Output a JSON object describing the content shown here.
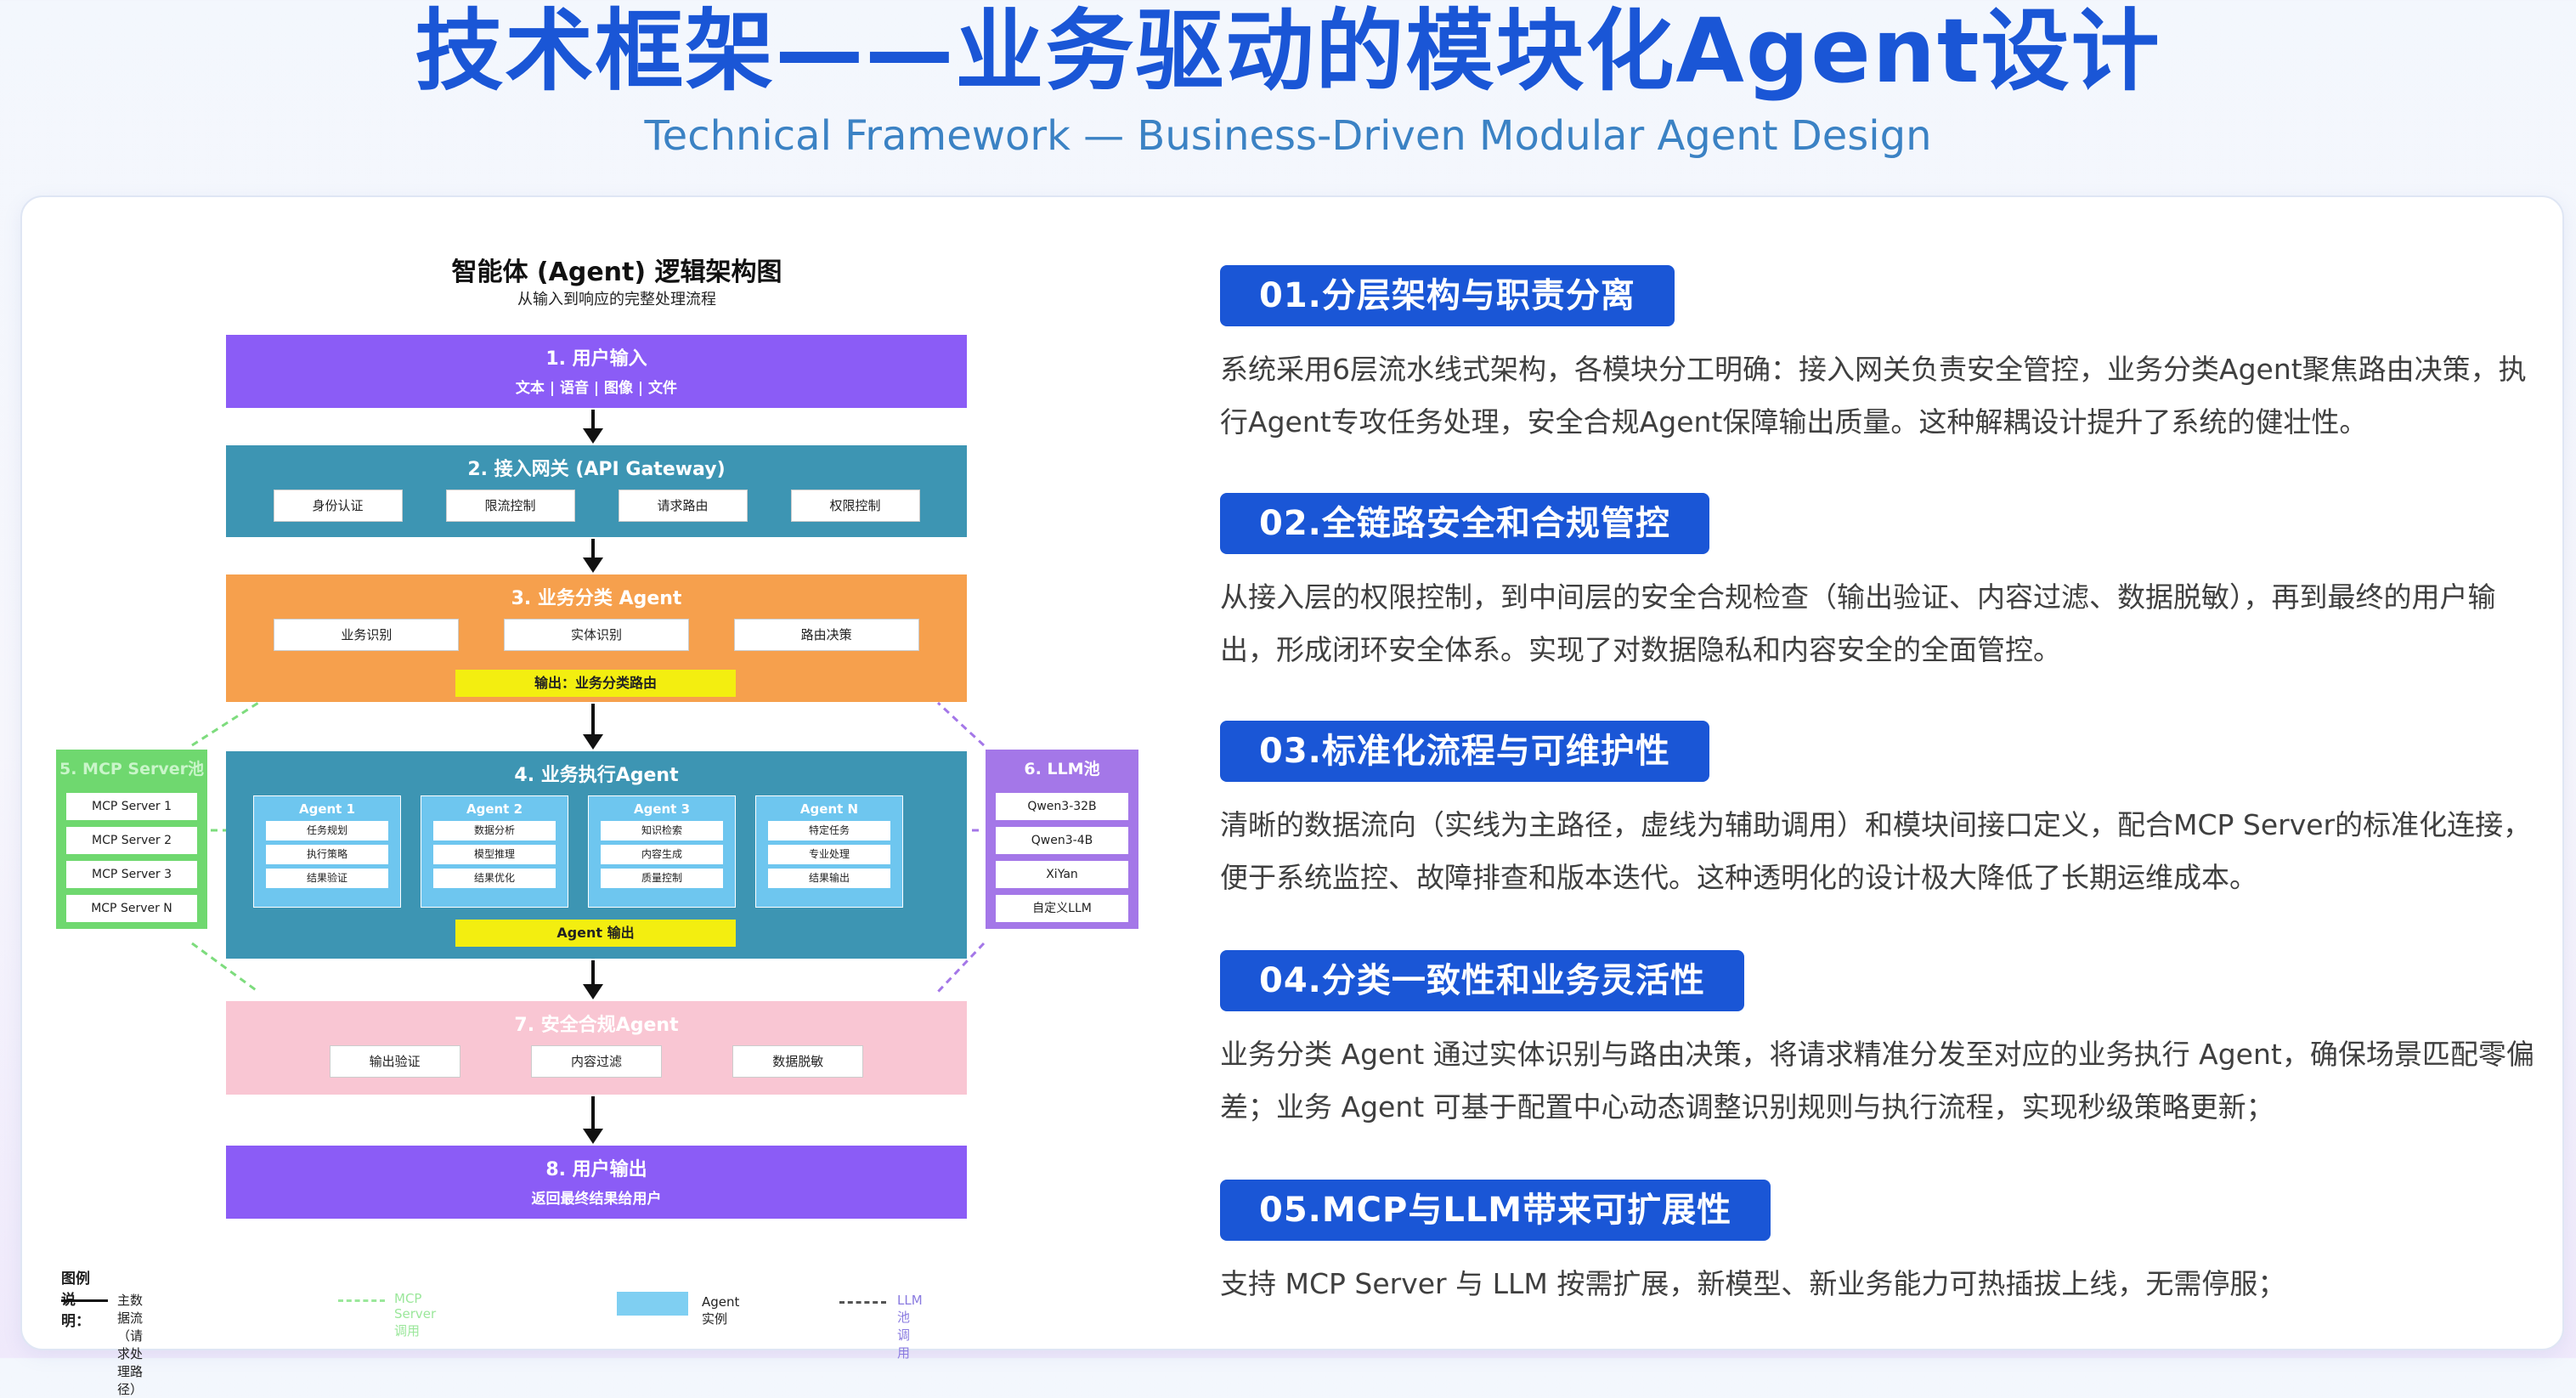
{
  "page": {
    "title": "技术框架——业务驱动的模块化Agent设计",
    "subtitle": "Technical Framework — Business-Driven Modular Agent Design"
  },
  "diagram": {
    "title": "智能体 (Agent) 逻辑架构图",
    "subtitle": "从输入到响应的完整处理流程",
    "layers": {
      "input": {
        "title": "1. 用户输入",
        "sub": "文本 | 语音 | 图像 | 文件",
        "color": "#8b5cf6"
      },
      "gateway": {
        "title": "2. 接入网关 (API Gateway)",
        "items": [
          "身份认证",
          "限流控制",
          "请求路由",
          "权限控制"
        ],
        "color": "#3d95b3"
      },
      "classify": {
        "title": "3. 业务分类 Agent",
        "items": [
          "业务识别",
          "实体识别",
          "路由决策"
        ],
        "output": "输出：业务分类路由",
        "color": "#f6a04d"
      },
      "execute": {
        "title": "4. 业务执行Agent",
        "color": "#3d95b3",
        "agents": [
          {
            "name": "Agent 1",
            "items": [
              "任务规划",
              "执行策略",
              "结果验证"
            ]
          },
          {
            "name": "Agent 2",
            "items": [
              "数据分析",
              "模型推理",
              "结果优化"
            ]
          },
          {
            "name": "Agent 3",
            "items": [
              "知识检索",
              "内容生成",
              "质量控制"
            ]
          },
          {
            "name": "Agent N",
            "items": [
              "特定任务",
              "专业处理",
              "结果输出"
            ]
          }
        ],
        "output": "Agent 输出"
      },
      "compliance": {
        "title": "7. 安全合规Agent",
        "items": [
          "输出验证",
          "内容过滤",
          "数据脱敏"
        ],
        "color": "#f9c6d3"
      },
      "output": {
        "title": "8. 用户输出",
        "sub": "返回最终结果给用户",
        "color": "#8b5cf6"
      }
    },
    "mcp": {
      "title": "5. MCP Server池",
      "items": [
        "MCP Server 1",
        "MCP Server 2",
        "MCP Server 3",
        "MCP Server N"
      ],
      "color": "#6fd86f"
    },
    "llm": {
      "title": "6. LLM池",
      "items": [
        "Qwen3-32B",
        "Qwen3-4B",
        "XiYan",
        "自定义LLM"
      ],
      "color": "#a477e8"
    },
    "legend": {
      "title": "图例说明：",
      "main_flow": "主数据流（请求处理路径）",
      "mcp_call": "MCP Server调用",
      "agent_instance": "Agent实例",
      "llm_call": "LLM池调用"
    }
  },
  "sections": [
    {
      "badge": "01.分层架构与职责分离",
      "text": "系统采用6层流水线式架构，各模块分工明确：接入网关负责安全管控，业务分类Agent聚焦路由决策，执行Agent专攻任务处理，安全合规Agent保障输出质量。这种解耦设计提升了系统的健壮性。"
    },
    {
      "badge": "02.全链路安全和合规管控",
      "text": "从接入层的权限控制，到中间层的安全合规检查（输出验证、内容过滤、数据脱敏），再到最终的用户输出，形成闭环安全体系。实现了对数据隐私和内容安全的全面管控。"
    },
    {
      "badge": "03.标准化流程与可维护性",
      "text": "清晰的数据流向（实线为主路径，虚线为辅助调用）和模块间接口定义，配合MCP Server的标准化连接，便于系统监控、故障排查和版本迭代。这种透明化的设计极大降低了长期运维成本。"
    },
    {
      "badge": "04.分类一致性和业务灵活性",
      "text": "业务分类 Agent 通过实体识别与路由决策，将请求精准分发至对应的业务执行 Agent，确保场景匹配零偏差；业务 Agent 可基于配置中心动态调整识别规则与执行流程，实现秒级策略更新；"
    },
    {
      "badge": "05.MCP与LLM带来可扩展性",
      "text": "支持 MCP Server 与 LLM 按需扩展，新模型、新业务能力可热插拔上线，无需停服；"
    }
  ]
}
